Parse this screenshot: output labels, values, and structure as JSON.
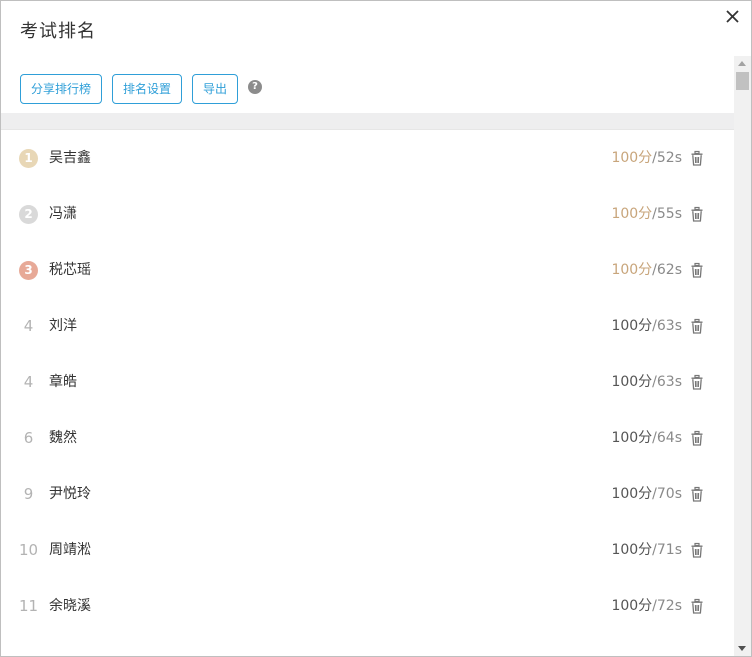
{
  "dialog": {
    "title": "考试排名"
  },
  "toolbar": {
    "share_label": "分享排行榜",
    "settings_label": "排名设置",
    "export_label": "导出",
    "help_glyph": "?"
  },
  "colors": {
    "accent": "#2f9fd8",
    "gold": "#e8d7b6",
    "silver": "#d9d9d9",
    "bronze": "#e7a997",
    "score_highlight": "#c8a57b"
  },
  "rows": [
    {
      "rank": "1",
      "medal": "gold",
      "name": "吴吉鑫",
      "points": "100分",
      "time": "/52s"
    },
    {
      "rank": "2",
      "medal": "silver",
      "name": "冯潇",
      "points": "100分",
      "time": "/55s"
    },
    {
      "rank": "3",
      "medal": "bronze",
      "name": "税芯瑶",
      "points": "100分",
      "time": "/62s"
    },
    {
      "rank": "4",
      "medal": "",
      "name": "刘洋",
      "points": "100分",
      "time": "/63s"
    },
    {
      "rank": "4",
      "medal": "",
      "name": "章皓",
      "points": "100分",
      "time": "/63s"
    },
    {
      "rank": "6",
      "medal": "",
      "name": "魏然",
      "points": "100分",
      "time": "/64s"
    },
    {
      "rank": "9",
      "medal": "",
      "name": "尹悦玲",
      "points": "100分",
      "time": "/70s"
    },
    {
      "rank": "10",
      "medal": "",
      "name": "周靖淞",
      "points": "100分",
      "time": "/71s"
    },
    {
      "rank": "11",
      "medal": "",
      "name": "余晓溪",
      "points": "100分",
      "time": "/72s"
    }
  ]
}
